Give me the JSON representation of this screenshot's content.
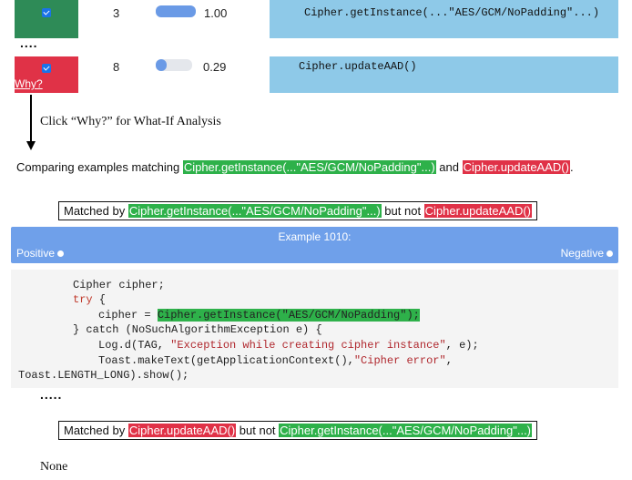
{
  "table": {
    "rows": [
      {
        "count": "3",
        "score": "1.00",
        "bar": 1.0,
        "code": "Cipher.getInstance(...\"AES/GCM/NoPadding\"...)",
        "color": "#2e8b57"
      },
      {
        "count": "8",
        "score": "0.29",
        "bar": 0.29,
        "code": "Cipher.updateAAD()",
        "color": "#e03247",
        "why_label": "Why?"
      }
    ],
    "ellipsis": "...."
  },
  "arrow_caption": "Click “Why?” for What-If Analysis",
  "comparing": {
    "prefix": "Comparing examples matching ",
    "a": "Cipher.getInstance(...\"AES/GCM/NoPadding\"...)",
    "mid": " and ",
    "b": "Cipher.updateAAD()",
    "suffix": "."
  },
  "match1": {
    "prefix": "Matched by ",
    "a": "Cipher.getInstance(...\"AES/GCM/NoPadding\"...)",
    "mid": " but not ",
    "b": "Cipher.updateAAD()"
  },
  "example": {
    "title": "Example 1010:",
    "positive": "Positive",
    "negative": "Negative"
  },
  "code": {
    "l1": "Cipher cipher;",
    "l2_kw": "try",
    "l2_rest": " {",
    "l3_pre": "cipher = ",
    "l3_hl_call": "Cipher.getInstance(",
    "l3_hl_str": "\"AES/GCM/NoPadding\"",
    "l3_hl_end": ");",
    "l4": "} catch (NoSuchAlgorithmException e) {",
    "l5_pre": "Log.d(TAG, ",
    "l5_str": "\"Exception while creating cipher instance\"",
    "l5_post": ", e);",
    "l6_pre": "Toast.makeText(getApplicationContext(),",
    "l6_str": "\"Cipher error\"",
    "l6_post": ",",
    "l7": "Toast.LENGTH_LONG).show();"
  },
  "ellipsis2": ".....",
  "match2": {
    "prefix": "Matched by ",
    "a": "Cipher.updateAAD()",
    "mid": " but not ",
    "b": "Cipher.getInstance(...\"AES/GCM/NoPadding\"...)"
  },
  "result": "None"
}
